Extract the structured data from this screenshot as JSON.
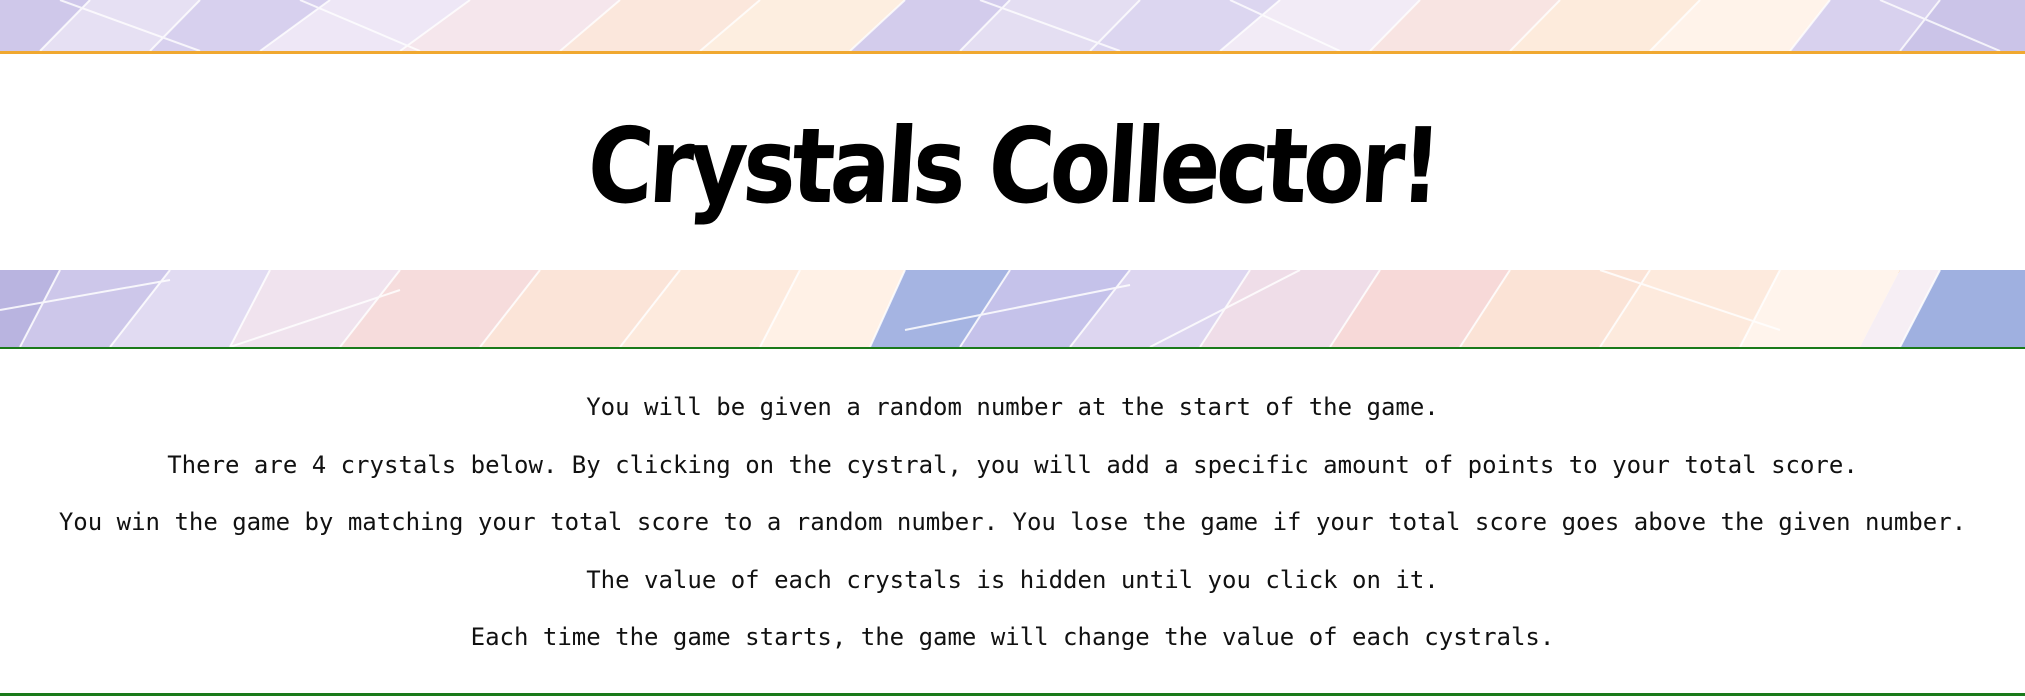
{
  "game": {
    "title": "Crystals Collector!"
  },
  "instructions": [
    "You will be given a random number at the start of the game.",
    "There are 4 crystals below. By clicking on the cystral, you will add a specific amount of points to your total score.",
    "You win the game by matching your total score to a random number. You lose the game if your total score goes above the given number.",
    "The value of each crystals is hidden until you click on it.",
    "Each time the game starts, the game will change the value of each cystrals."
  ],
  "colors": {
    "title_band_border": "#f0a830",
    "rules_border": "#1a7a1a",
    "background_pattern": [
      "#c9c4e6",
      "#e7e0f2",
      "#f8dcd8",
      "#fde9d8",
      "#9aaee0",
      "#ffffff"
    ]
  }
}
